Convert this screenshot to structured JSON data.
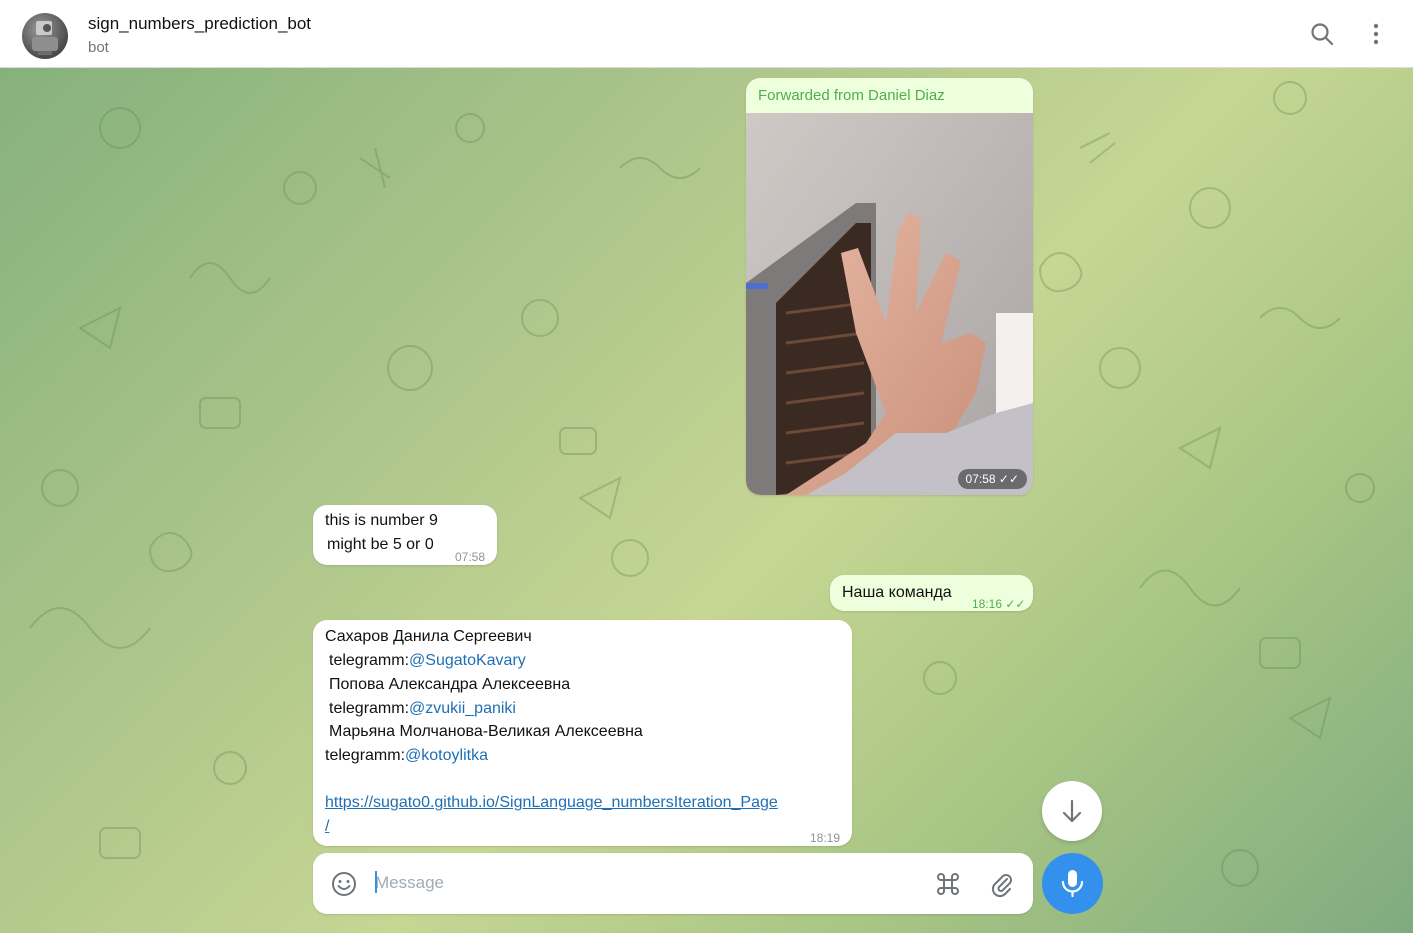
{
  "header": {
    "bot_name": "sign_numbers_prediction_bot",
    "bot_status": "bot",
    "icons": [
      "avatar",
      "search-icon",
      "more-vertical-icon"
    ]
  },
  "messages": {
    "forwarded": {
      "label": "Forwarded from Daniel Diaz",
      "time": "07:58"
    },
    "reply_prediction": {
      "line1": "this is number 9",
      "line2": "might be 5 or 0",
      "time": "07:58"
    },
    "team": {
      "text": "Наша команда",
      "time": "18:16"
    },
    "team_list": {
      "name1": "Сахаров Данила Сергеевич",
      "tg_prefix1": "telegramm:",
      "tg_link1": "@SugatoKavary",
      "name2": "Попова Александра Алексеевна",
      "tg_prefix2": "telegramm:",
      "tg_link2": "@zvukii_paniki",
      "name3": "Марьяна Молчанова-Великая Алексеевна",
      "tg_prefix3": "telegramm:",
      "tg_link3": "@kotoylitka",
      "url_line1": "https://sugato0.github.io/SignLanguage_numbersIteration_Page",
      "url_line2": "/",
      "time": "18:19"
    }
  },
  "composer": {
    "placeholder": "Message",
    "icons": [
      "emoji-icon",
      "command-icon",
      "attach-icon",
      "microphone-icon"
    ]
  },
  "colors": {
    "accent": "#3390ec",
    "outgoing_bubble": "#eeffde",
    "link": "#1e6fb4",
    "check_green": "#4fae4e"
  }
}
